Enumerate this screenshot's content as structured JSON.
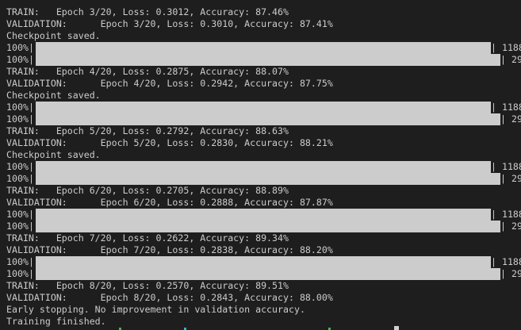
{
  "terminal": {
    "lines": [
      {
        "kind": "text",
        "text": "TRAIN:   Epoch 3/20, Loss: 0.3012, Accuracy: 87.46%"
      },
      {
        "kind": "text",
        "text": "VALIDATION:      Epoch 3/20, Loss: 0.3010, Accuracy: 87.41%"
      },
      {
        "kind": "text",
        "text": "Checkpoint saved."
      },
      {
        "kind": "progress",
        "split": "train",
        "percent": "100%",
        "count": "1188",
        "progress_fraction": 1.0
      },
      {
        "kind": "progress",
        "split": "val",
        "percent": "100%",
        "count": "29",
        "progress_fraction": 1.0
      },
      {
        "kind": "text",
        "text": "TRAIN:   Epoch 4/20, Loss: 0.2875, Accuracy: 88.07%"
      },
      {
        "kind": "text",
        "text": "VALIDATION:      Epoch 4/20, Loss: 0.2942, Accuracy: 87.75%"
      },
      {
        "kind": "text",
        "text": "Checkpoint saved."
      },
      {
        "kind": "progress",
        "split": "train",
        "percent": "100%",
        "count": "1188",
        "progress_fraction": 1.0
      },
      {
        "kind": "progress",
        "split": "val",
        "percent": "100%",
        "count": "29",
        "progress_fraction": 1.0
      },
      {
        "kind": "text",
        "text": "TRAIN:   Epoch 5/20, Loss: 0.2792, Accuracy: 88.63%"
      },
      {
        "kind": "text",
        "text": "VALIDATION:      Epoch 5/20, Loss: 0.2830, Accuracy: 88.21%"
      },
      {
        "kind": "text",
        "text": "Checkpoint saved."
      },
      {
        "kind": "progress",
        "split": "train",
        "percent": "100%",
        "count": "1188",
        "progress_fraction": 1.0
      },
      {
        "kind": "progress",
        "split": "val",
        "percent": "100%",
        "count": "29",
        "progress_fraction": 1.0
      },
      {
        "kind": "text",
        "text": "TRAIN:   Epoch 6/20, Loss: 0.2705, Accuracy: 88.89%"
      },
      {
        "kind": "text",
        "text": "VALIDATION:      Epoch 6/20, Loss: 0.2888, Accuracy: 87.87%"
      },
      {
        "kind": "progress",
        "split": "train",
        "percent": "100%",
        "count": "1188",
        "progress_fraction": 1.0
      },
      {
        "kind": "progress",
        "split": "val",
        "percent": "100%",
        "count": "29",
        "progress_fraction": 1.0
      },
      {
        "kind": "text",
        "text": "TRAIN:   Epoch 7/20, Loss: 0.2622, Accuracy: 89.34%"
      },
      {
        "kind": "text",
        "text": "VALIDATION:      Epoch 7/20, Loss: 0.2838, Accuracy: 88.20%"
      },
      {
        "kind": "progress",
        "split": "train",
        "percent": "100%",
        "count": "1188",
        "progress_fraction": 1.0
      },
      {
        "kind": "progress",
        "split": "val",
        "percent": "100%",
        "count": "29",
        "progress_fraction": 1.0
      },
      {
        "kind": "text",
        "text": "TRAIN:   Epoch 8/20, Loss: 0.2570, Accuracy: 89.51%"
      },
      {
        "kind": "text",
        "text": "VALIDATION:      Epoch 8/20, Loss: 0.2843, Accuracy: 88.00%"
      },
      {
        "kind": "text",
        "text": "Early stopping. No improvement in validation accuracy."
      },
      {
        "kind": "text",
        "text": "Training finished."
      }
    ]
  },
  "colors": {
    "background": "#1e1e1e",
    "foreground": "#cccccc",
    "bar": "#cccccc",
    "status_green": "#3fb950",
    "status_cyan": "#29b8db"
  }
}
